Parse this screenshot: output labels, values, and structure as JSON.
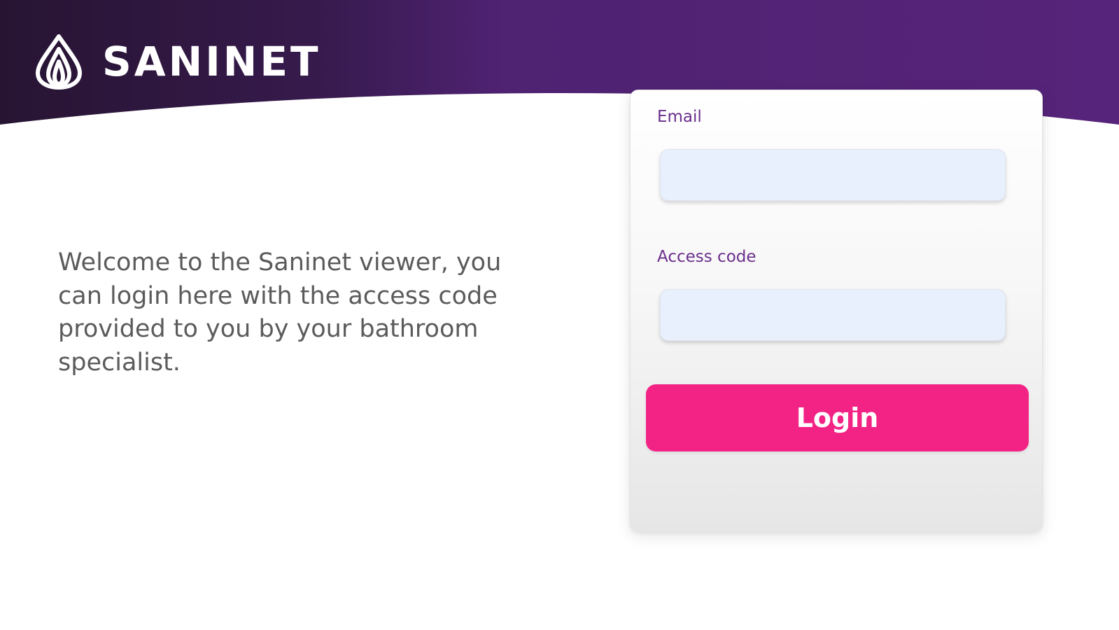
{
  "brand": {
    "name": "SANINET",
    "logo_icon": "drop-icon"
  },
  "welcome": {
    "text": "Welcome to the Saninet viewer, you can login here with the access code provided to you by your bathroom specialist."
  },
  "login_form": {
    "email_label": "Email",
    "email_value": "",
    "access_code_label": "Access code",
    "access_code_value": "",
    "login_button_label": "Login"
  },
  "colors": {
    "header_dark": "#271432",
    "header_purple": "#56247a",
    "label_purple": "#6a2e8c",
    "input_fill": "#e8f0fe",
    "login_button": "#f32386",
    "body_text": "#5b5b5b"
  }
}
